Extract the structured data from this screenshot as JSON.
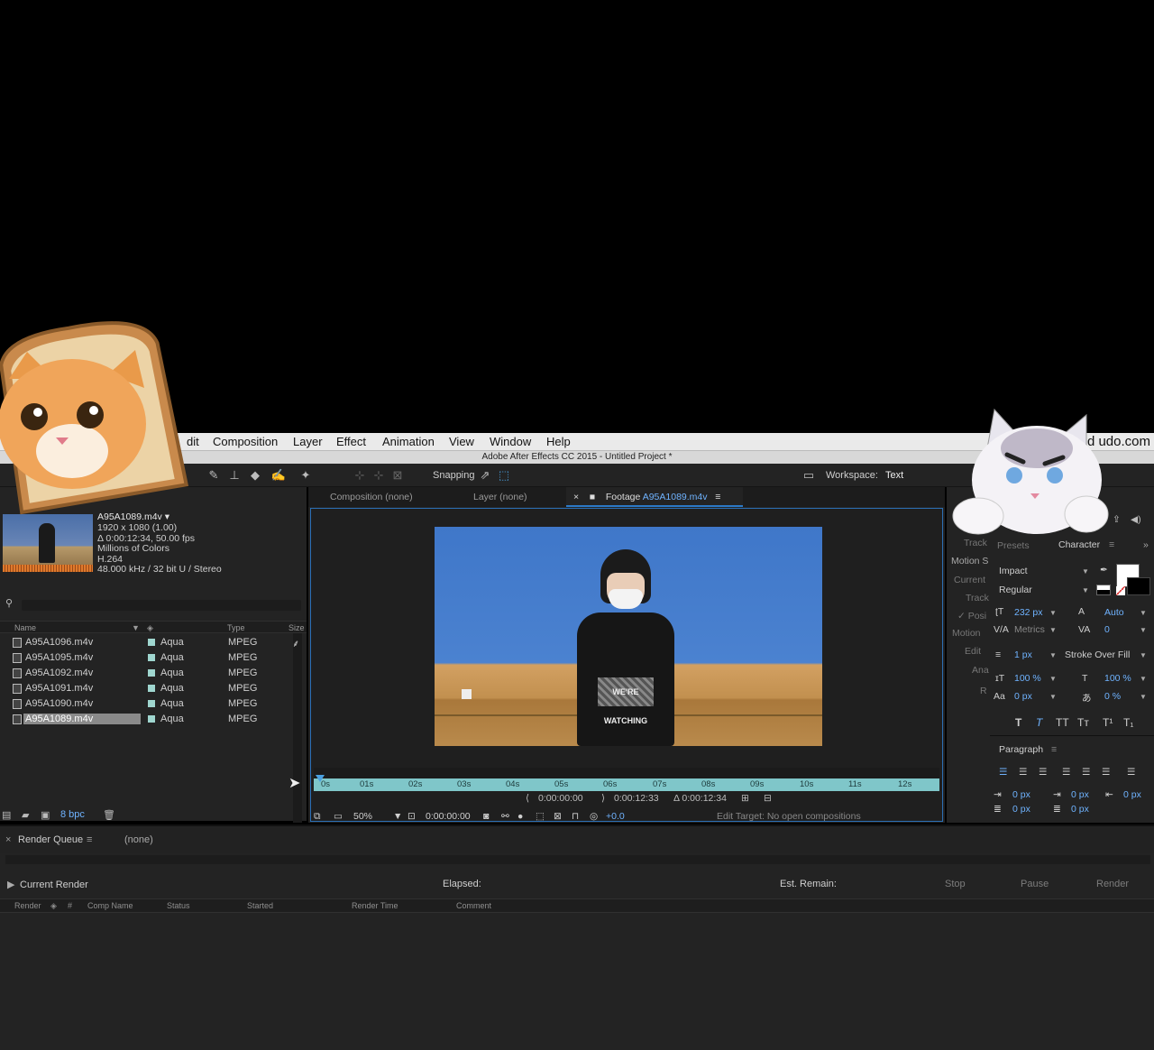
{
  "menubar": {
    "items": [
      "dit",
      "Composition",
      "Layer",
      "Effect",
      "Animation",
      "View",
      "Window",
      "Help"
    ],
    "watermark": "d     udo.com"
  },
  "window_title": "Adobe After Effects CC 2015 - Untitled Project *",
  "toolbar": {
    "snapping_label": "Snapping",
    "workspace_label": "Workspace:",
    "workspace_value": "Text"
  },
  "project": {
    "selected_name": "A95A1089.m4v ▾",
    "info_lines": [
      "1920 x 1080 (1.00)",
      "Δ 0:00:12:34, 50.00 fps",
      "Millions of Colors",
      "H.264",
      "48.000 kHz / 32 bit U / Stereo"
    ],
    "search_icon": "search-icon",
    "columns": {
      "name": "Name",
      "type": "Type",
      "size": "Size"
    },
    "rows": [
      {
        "name": "A95A1096.m4v",
        "label": "Aqua",
        "type": "MPEG"
      },
      {
        "name": "A95A1095.m4v",
        "label": "Aqua",
        "type": "MPEG"
      },
      {
        "name": "A95A1092.m4v",
        "label": "Aqua",
        "type": "MPEG"
      },
      {
        "name": "A95A1091.m4v",
        "label": "Aqua",
        "type": "MPEG"
      },
      {
        "name": "A95A1090.m4v",
        "label": "Aqua",
        "type": "MPEG"
      },
      {
        "name": "A95A1089.m4v",
        "label": "Aqua",
        "type": "MPEG"
      }
    ],
    "bpc": "8 bpc"
  },
  "viewer": {
    "tabs": [
      "Composition (none)",
      "Layer (none)"
    ],
    "active_tab_prefix": "Footage",
    "active_tab_name": "A95A1089.m4v",
    "shirt_text": "WE'RE WATCHING",
    "ticks": [
      "0s",
      "01s",
      "02s",
      "03s",
      "04s",
      "05s",
      "06s",
      "07s",
      "08s",
      "09s",
      "10s",
      "11s",
      "12s"
    ],
    "in_time": "0:00:00:00",
    "out_time": "0:00:12:33",
    "duration": "Δ 0:00:12:34",
    "zoom": "50%",
    "current_time": "0:00:00:00",
    "exposure": "+0.0",
    "edit_target": "Edit Target: No open compositions"
  },
  "right": {
    "left_labels": [
      "Track",
      "Motion S",
      "Current",
      "Track",
      "✓ Posi",
      "Motion",
      "Edit",
      "Ana",
      "R"
    ],
    "presets_label": "Presets",
    "character_title": "Character",
    "font": "Impact",
    "style": "Regular",
    "font_size": "232 px",
    "leading": "Auto",
    "kerning": "Metrics",
    "tracking": "0",
    "stroke_width": "1 px",
    "stroke_mode": "Stroke Over Fill",
    "vert_scale": "100 %",
    "horiz_scale": "100 %",
    "baseline": "0 px",
    "tsume": "0 %",
    "type_buttons": [
      "T",
      "T",
      "TT",
      "Tт",
      "T¹",
      "T₁"
    ],
    "paragraph_title": "Paragraph",
    "indent_left": "0 px",
    "indent_first": "0 px",
    "indent_right": "0 px",
    "space_before": "0 px",
    "space_after": "0 px"
  },
  "render_queue": {
    "title": "Render Queue",
    "comp": "(none)",
    "current_render": "Current Render",
    "elapsed": "Elapsed:",
    "est_remain": "Est. Remain:",
    "stop": "Stop",
    "pause": "Pause",
    "render": "Render",
    "columns": [
      "Render",
      "#",
      "Comp Name",
      "Status",
      "Started",
      "Render Time",
      "Comment"
    ]
  },
  "colors": {
    "accent": "#2b78c6",
    "label_aqua": "#9fd6cf",
    "ruler": "#7fc6c9"
  }
}
